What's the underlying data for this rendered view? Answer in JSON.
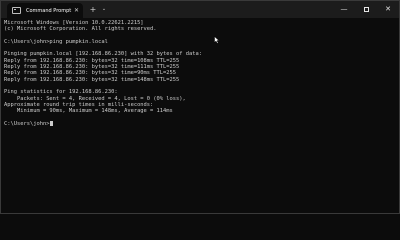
{
  "window": {
    "tab_title": "Command Prompt",
    "new_tab_symbol": "+",
    "dropdown_symbol": "⌄",
    "tab_close_symbol": "✕",
    "minimize_symbol": "—",
    "close_symbol": "✕"
  },
  "terminal": {
    "lines": [
      "Microsoft Windows [Version 10.0.22621.2215]",
      "(c) Microsoft Corporation. All rights reserved.",
      "",
      "C:\\Users\\john>ping pumpkin.local",
      "",
      "Pinging pumpkin.local [192.168.86.230] with 32 bytes of data:",
      "Reply from 192.168.86.230: bytes=32 time=108ms TTL=255",
      "Reply from 192.168.86.230: bytes=32 time=111ms TTL=255",
      "Reply from 192.168.86.230: bytes=32 time=90ms TTL=255",
      "Reply from 192.168.86.230: bytes=32 time=148ms TTL=255",
      "",
      "Ping statistics for 192.168.86.230:",
      "    Packets: Sent = 4, Received = 4, Lost = 0 (0% loss),",
      "Approximate round trip times in milli-seconds:",
      "    Minimum = 90ms, Maximum = 148ms, Average = 114ms",
      ""
    ],
    "prompt": "C:\\Users\\john>"
  },
  "colors": {
    "background": "#0c0c0c",
    "titlebar": "#1c1c1c",
    "text": "#cccccc"
  }
}
